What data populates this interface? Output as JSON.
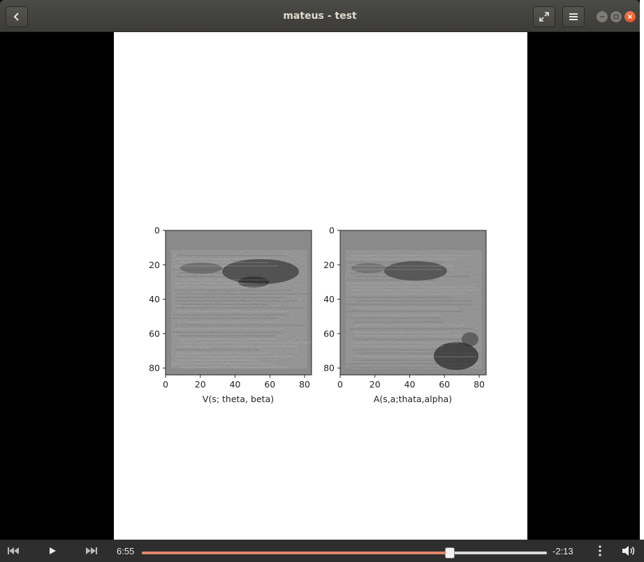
{
  "window": {
    "title": "mateus - test"
  },
  "header": {
    "back_icon": "chevron-left-icon",
    "fullscreen_icon": "expand-arrows-icon",
    "menu_icon": "hamburger-menu-icon"
  },
  "plots": [
    {
      "xlabel": "V(s; theta, beta)",
      "xticks": [
        "0",
        "20",
        "40",
        "60",
        "80"
      ],
      "yticks": [
        "0",
        "20",
        "40",
        "60",
        "80"
      ]
    },
    {
      "xlabel": "A(s,a;thata,alpha)",
      "xticks": [
        "0",
        "20",
        "40",
        "60",
        "80"
      ],
      "yticks": [
        "0",
        "20",
        "40",
        "60",
        "80"
      ]
    }
  ],
  "playback": {
    "elapsed": "6:55",
    "remaining": "-2:13",
    "progress": 0.76,
    "accent_color": "#e2866a"
  },
  "controls": {
    "prev_icon": "skip-back-icon",
    "play_icon": "play-icon",
    "next_icon": "skip-forward-icon",
    "more_icon": "vertical-dots-icon",
    "volume_icon": "volume-icon"
  }
}
